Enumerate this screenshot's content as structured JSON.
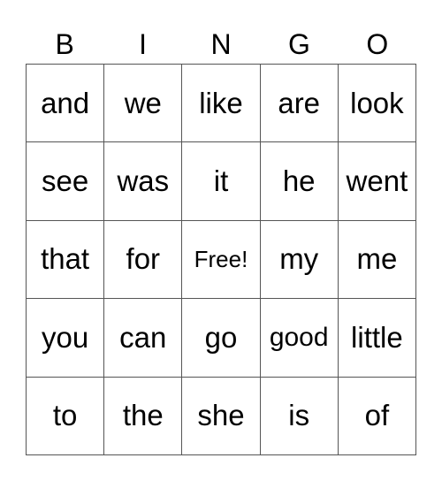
{
  "header": [
    "B",
    "I",
    "N",
    "G",
    "O"
  ],
  "rows": [
    [
      "and",
      "we",
      "like",
      "are",
      "look"
    ],
    [
      "see",
      "was",
      "it",
      "he",
      "went"
    ],
    [
      "that",
      "for",
      "Free!",
      "my",
      "me"
    ],
    [
      "you",
      "can",
      "go",
      "good",
      "little"
    ],
    [
      "to",
      "the",
      "she",
      "is",
      "of"
    ]
  ]
}
